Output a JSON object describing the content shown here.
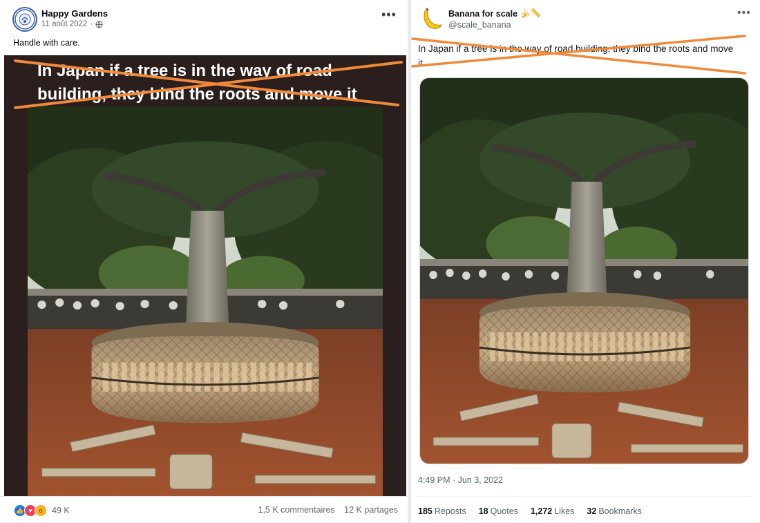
{
  "facebook_post": {
    "page_name": "Happy Gardens",
    "date": "11 août 2022",
    "privacy_icon": "globe-icon",
    "post_text": "Handle with care.",
    "image_caption": "In Japan if a tree is in the way of road building, they bind the roots and move it",
    "reactions": {
      "icons": [
        "like-icon",
        "love-icon",
        "wow-icon"
      ],
      "count": "49 K"
    },
    "comments": "1,5 K commentaires",
    "shares": "12 K partages"
  },
  "twitter_post": {
    "display_name": "Banana for scale",
    "name_emojis": "🍌📏",
    "handle": "@scale_banana",
    "text": "In Japan if a tree is in the way of road building, they bind the roots and move it.",
    "timestamp": "4:49 PM · Jun 3, 2022",
    "stats": {
      "reposts_value": "185",
      "reposts_label": "Reposts",
      "quotes_value": "18",
      "quotes_label": "Quotes",
      "likes_value": "1,272",
      "likes_label": "Likes",
      "bookmarks_value": "32",
      "bookmarks_label": "Bookmarks"
    }
  },
  "colors": {
    "strike": "#f08a3a",
    "facebook_link": "#65676b",
    "twitter_secondary": "#536471"
  }
}
